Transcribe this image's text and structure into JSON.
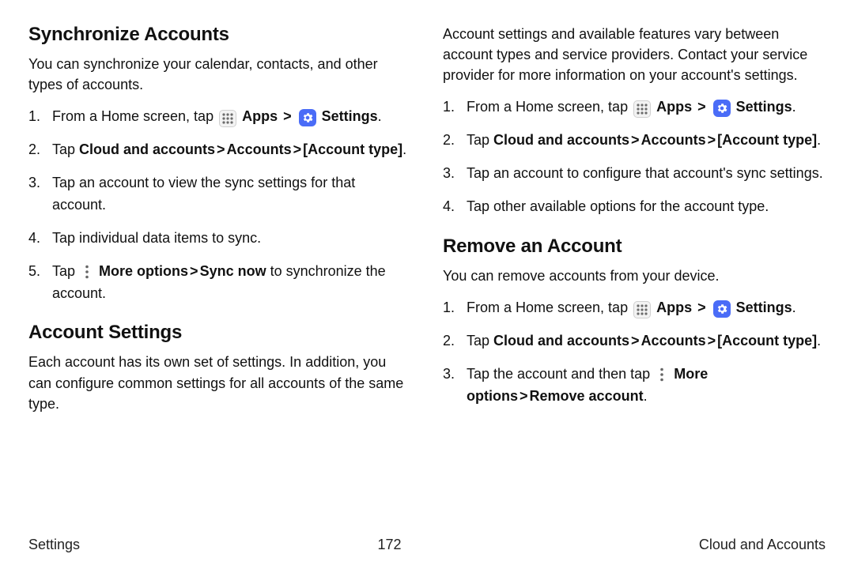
{
  "left": {
    "sync": {
      "heading": "Synchronize Accounts",
      "intro": "You can synchronize your calendar, contacts, and other types of accounts.",
      "steps": {
        "s1_a": "From a Home screen, tap ",
        "s1_apps": "Apps",
        "s1_settings": "Settings",
        "s2_a": "Tap ",
        "s2_b": "Cloud and accounts",
        "s2_c": "Accounts",
        "s2_d": "[Account type]",
        "s3": "Tap an account to view the sync settings for that account.",
        "s4": "Tap individual data items to sync.",
        "s5_a": "Tap ",
        "s5_b": "More options",
        "s5_c": "Sync now",
        "s5_d": " to synchronize the account."
      }
    },
    "acct": {
      "heading": "Account Settings",
      "intro": "Each account has its own set of settings. In addition, you can configure common settings for all accounts of the same type."
    }
  },
  "right": {
    "intro": "Account settings and available features vary between account types and service providers. Contact your service provider for more information on your account's settings.",
    "steps": {
      "s1_a": "From a Home screen, tap ",
      "s1_apps": "Apps",
      "s1_settings": "Settings",
      "s2_a": "Tap ",
      "s2_b": "Cloud and accounts",
      "s2_c": "Accounts",
      "s2_d": "[Account type]",
      "s3": "Tap an account to configure that account's sync settings.",
      "s4": "Tap other available options for the account type."
    },
    "remove": {
      "heading": "Remove an Account",
      "intro": "You can remove accounts from your device.",
      "steps": {
        "s1_a": "From a Home screen, tap ",
        "s1_apps": "Apps",
        "s1_settings": "Settings",
        "s2_a": "Tap ",
        "s2_b": "Cloud and accounts",
        "s2_c": "Accounts",
        "s2_d": "[Account type]",
        "s3_a": "Tap the account and then tap ",
        "s3_b": "More options",
        "s3_c": "Remove account"
      }
    }
  },
  "footer": {
    "left": "Settings",
    "center": "172",
    "right": "Cloud and Accounts"
  },
  "glyphs": {
    "chevron": ">",
    "period": "."
  }
}
